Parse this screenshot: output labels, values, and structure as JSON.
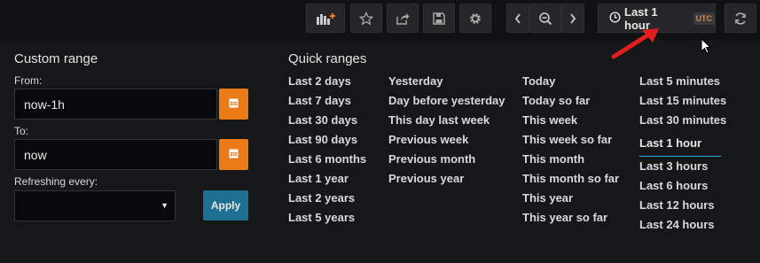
{
  "toolbar": {
    "icons": [
      "add-panel-icon",
      "star-icon",
      "share-icon",
      "save-icon",
      "settings-icon",
      "chevron-left-icon",
      "zoom-out-icon",
      "chevron-right-icon",
      "refresh-icon"
    ],
    "time_label": "Last 1 hour",
    "utc_badge": "UTC"
  },
  "custom_range": {
    "title": "Custom range",
    "from_label": "From:",
    "from_value": "now-1h",
    "to_label": "To:",
    "to_value": "now",
    "refresh_label": "Refreshing every:",
    "apply_label": "Apply"
  },
  "quick_ranges": {
    "title": "Quick ranges",
    "columns": [
      [
        "Last 2 days",
        "Last 7 days",
        "Last 30 days",
        "Last 90 days",
        "Last 6 months",
        "Last 1 year",
        "Last 2 years",
        "Last 5 years"
      ],
      [
        "Yesterday",
        "Day before yesterday",
        "This day last week",
        "Previous week",
        "Previous month",
        "Previous year"
      ],
      [
        "Today",
        "Today so far",
        "This week",
        "This week so far",
        "This month",
        "This month so far",
        "This year",
        "This year so far"
      ],
      [
        "Last 5 minutes",
        "Last 15 minutes",
        "Last 30 minutes",
        "Last 1 hour",
        "Last 3 hours",
        "Last 6 hours",
        "Last 12 hours",
        "Last 24 hours"
      ]
    ],
    "active": "Last 1 hour"
  },
  "colors": {
    "accent_orange": "#eb7b18",
    "apply_blue": "#1f6f93",
    "active_underline": "#3aa7df",
    "annotation_arrow": "#e0201e"
  }
}
